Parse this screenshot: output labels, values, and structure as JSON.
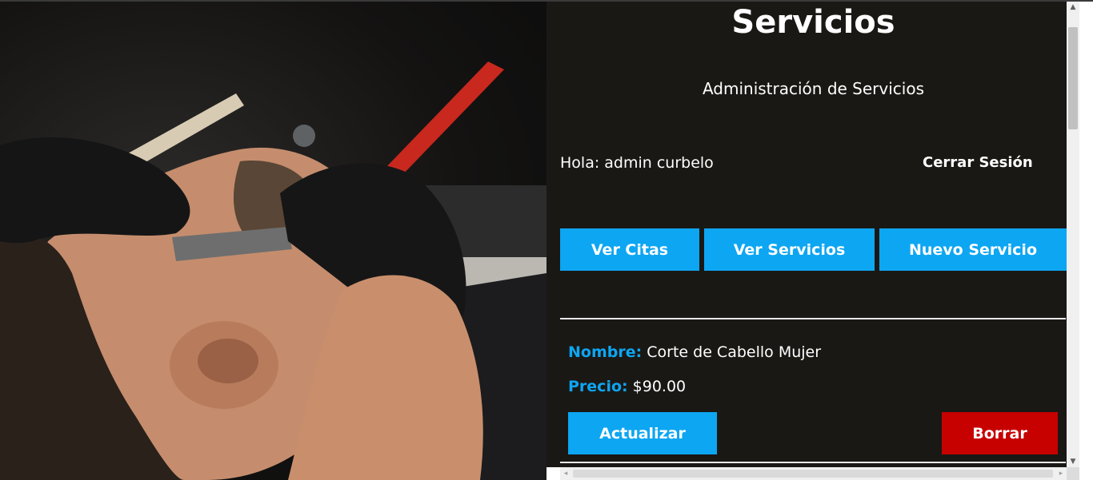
{
  "header": {
    "title": "Servicios",
    "subtitle": "Administración de Servicios"
  },
  "user_bar": {
    "greeting": "Hola: admin curbelo",
    "logout_label": "Cerrar Sesión"
  },
  "nav": {
    "items": [
      {
        "label": "Ver Citas"
      },
      {
        "label": "Ver Servicios"
      },
      {
        "label": "Nuevo Servicio"
      }
    ]
  },
  "service": {
    "name_label": "Nombre:",
    "name_value": "Corte de Cabello Mujer",
    "price_label": "Precio:",
    "price_value": "$90.00",
    "update_label": "Actualizar",
    "delete_label": "Borrar"
  },
  "colors": {
    "panel_bg": "#1a1815",
    "accent_blue": "#0da6f2",
    "danger_red": "#c70000",
    "text": "#ffffff"
  },
  "icons": {
    "scroll_up": "▲",
    "scroll_down": "▼",
    "scroll_left": "◂",
    "scroll_right": "▸"
  }
}
